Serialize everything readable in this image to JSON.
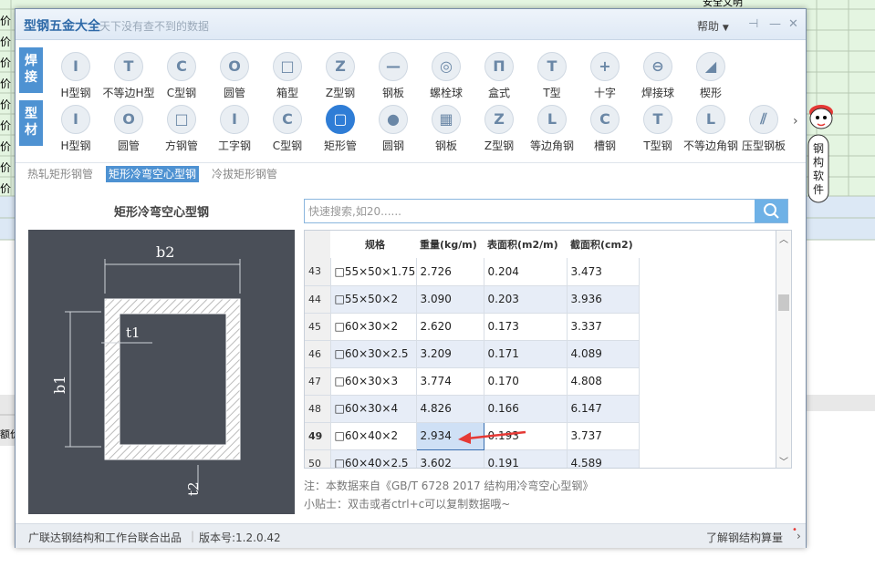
{
  "background": {
    "left_col_text": [
      "价",
      "价",
      "价",
      "价",
      "价",
      "价",
      "价",
      "价",
      "价"
    ],
    "top_right_text": "安全文明",
    "bottom_left_text": "额价"
  },
  "window": {
    "title": "型钢五金大全",
    "subtitle": "天下没有查不到的数据",
    "help": "帮助",
    "pin_icon": "pin-icon",
    "min_icon": "minimize-icon",
    "close_icon": "close-icon"
  },
  "categories": [
    {
      "tag": [
        "焊",
        "接"
      ],
      "items": [
        "H型钢",
        "不等边H型",
        "C型钢",
        "圆管",
        "箱型",
        "Z型钢",
        "钢板",
        "螺栓球",
        "盒式",
        "T型",
        "十字",
        "焊接球",
        "楔形"
      ]
    },
    {
      "tag": [
        "型",
        "材"
      ],
      "items": [
        "H型钢",
        "圆管",
        "方钢管",
        "工字钢",
        "C型钢",
        "矩形管",
        "圆钢",
        "钢板",
        "Z型钢",
        "等边角钢",
        "槽钢",
        "T型钢",
        "不等边角钢",
        "压型钢板"
      ],
      "selected_index": 5
    }
  ],
  "subtabs": [
    "热轧矩形钢管",
    "矩形冷弯空心型钢",
    "冷拔矩形钢管"
  ],
  "active_subtab": 1,
  "product_title": "矩形冷弯空心型钢",
  "diagram": {
    "b2": "b2",
    "b1": "b1",
    "t1": "t1",
    "t2": "t2"
  },
  "search": {
    "placeholder": "快速搜索,如20......"
  },
  "table": {
    "headers": [
      "规格",
      "重量(kg/m)",
      "表面积(m2/m)",
      "截面积(cm2)"
    ],
    "rows": [
      {
        "n": "43",
        "spec": "□55×50×1.75",
        "w": "2.726",
        "s": "0.204",
        "a": "3.473"
      },
      {
        "n": "44",
        "spec": "□55×50×2",
        "w": "3.090",
        "s": "0.203",
        "a": "3.936"
      },
      {
        "n": "45",
        "spec": "□60×30×2",
        "w": "2.620",
        "s": "0.173",
        "a": "3.337"
      },
      {
        "n": "46",
        "spec": "□60×30×2.5",
        "w": "3.209",
        "s": "0.171",
        "a": "4.089"
      },
      {
        "n": "47",
        "spec": "□60×30×3",
        "w": "3.774",
        "s": "0.170",
        "a": "4.808"
      },
      {
        "n": "48",
        "spec": "□60×30×4",
        "w": "4.826",
        "s": "0.166",
        "a": "6.147"
      },
      {
        "n": "49",
        "spec": "□60×40×2",
        "w": "2.934",
        "s": "0.193",
        "a": "3.737"
      },
      {
        "n": "50",
        "spec": "□60×40×2.5",
        "w": "3.602",
        "s": "0.191",
        "a": "4.589"
      }
    ],
    "selected_row": 6
  },
  "notes": {
    "source": "注：本数据来自《GB/T 6728 2017  结构用冷弯空心型钢》",
    "tip": "小贴士：双击或者ctrl+c可以复制数据哦~"
  },
  "footer": {
    "left": "广联达钢结构和工作台联合出品",
    "version": "版本号:1.2.0.42",
    "right": "了解钢结构算量"
  },
  "mascot": {
    "text": [
      "钢",
      "构",
      "软",
      "件"
    ]
  },
  "colors": {
    "accent": "#4e92d2",
    "selected": "#2f7dd6",
    "arrow": "#e53935"
  }
}
